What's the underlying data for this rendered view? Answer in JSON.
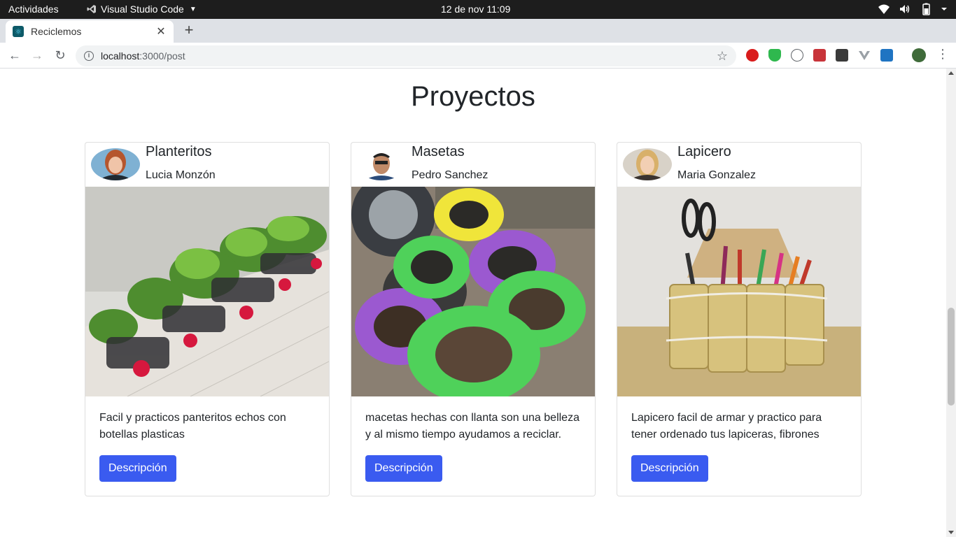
{
  "system_bar": {
    "activities": "Actividades",
    "app_name": "Visual Studio Code",
    "clock": "12 de nov  11:09"
  },
  "browser": {
    "tab_title": "Reciclemos",
    "url_host": "localhost",
    "url_path": ":3000/post"
  },
  "page": {
    "title": "Proyectos",
    "cards": [
      {
        "title": "Planteritos",
        "author": "Lucia Monzón",
        "description": "Facil y practicos panteritos echos con botellas plasticas",
        "button": "Descripción"
      },
      {
        "title": "Masetas",
        "author": "Pedro Sanchez",
        "description": "macetas hechas con llanta son una belleza y al mismo tiempo ayudamos a reciclar.",
        "button": "Descripción"
      },
      {
        "title": "Lapicero",
        "author": "Maria Gonzalez",
        "description": "Lapicero facil de armar y practico para tener ordenado tus lapiceras, fibrones",
        "button": "Descripción"
      }
    ]
  },
  "colors": {
    "primary_button": "#3a5bf0",
    "topbar": "#1d1d1d"
  }
}
